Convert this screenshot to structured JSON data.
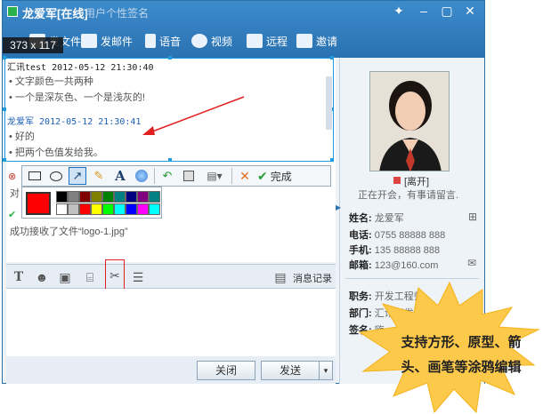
{
  "title": {
    "name": "龙爱军[在线]",
    "signature": "用户个性签名"
  },
  "toolbar": {
    "items": [
      {
        "label": "发文件"
      },
      {
        "label": "发邮件"
      },
      {
        "label": "语音"
      },
      {
        "label": "视频"
      },
      {
        "label": "远程"
      },
      {
        "label": "邀请"
      }
    ]
  },
  "capture": {
    "size_label": "373 x 117"
  },
  "messages": [
    {
      "sender": "汇讯test",
      "time": "2012-05-12 21:30:40",
      "lines": [
        "• 文字颜色一共两种",
        "• 一个是深灰色、一个是浅灰的!"
      ]
    },
    {
      "sender": "龙爱军",
      "time": "2012-05-12 21:30:41",
      "lines": [
        "• 好的",
        "• 把两个色值发给我。"
      ]
    }
  ],
  "draw_toolbar": {
    "done_label": "完成"
  },
  "palette": {
    "current": "#ff0000",
    "colors": [
      "#000000",
      "#808080",
      "#800000",
      "#808000",
      "#008000",
      "#008080",
      "#000080",
      "#800080",
      "#008080",
      "#ffffff",
      "#c0c0c0",
      "#ff0000",
      "#ffff00",
      "#00ff00",
      "#00ffff",
      "#0000ff",
      "#ff00ff",
      "#00ffff"
    ]
  },
  "chat_below": {
    "partial_text": "对",
    "file_received": "成功接收了文件“logo-1.jpg”"
  },
  "input_toolbar": {
    "history_label": "消息记录"
  },
  "bottom": {
    "close_label": "关闭",
    "send_label": "发送"
  },
  "contact": {
    "status": "[离开]",
    "status_msg": "正在开会，有事请留言.",
    "name_k": "姓名:",
    "name_v": "龙爱军",
    "phone_k": "电话:",
    "phone_v": "0755 88888 888",
    "mobile_k": "手机:",
    "mobile_v": "135 88888 888",
    "email_k": "邮箱:",
    "email_v": "123@160.com",
    "job_k": "职务:",
    "job_v": "开发工程师",
    "dept_k": "部门:",
    "dept_v": "汇讯开发",
    "sign_k": "签名:",
    "sign_v": "嗨"
  },
  "callout": {
    "text": "支持方形、原型、箭头、画笔等涂鸦编辑"
  },
  "colors": {
    "titlebar": "#2a72b2",
    "selection": "#1f9be0",
    "burst": "#fcc94a",
    "annotation_arrow": "#e0201e"
  }
}
